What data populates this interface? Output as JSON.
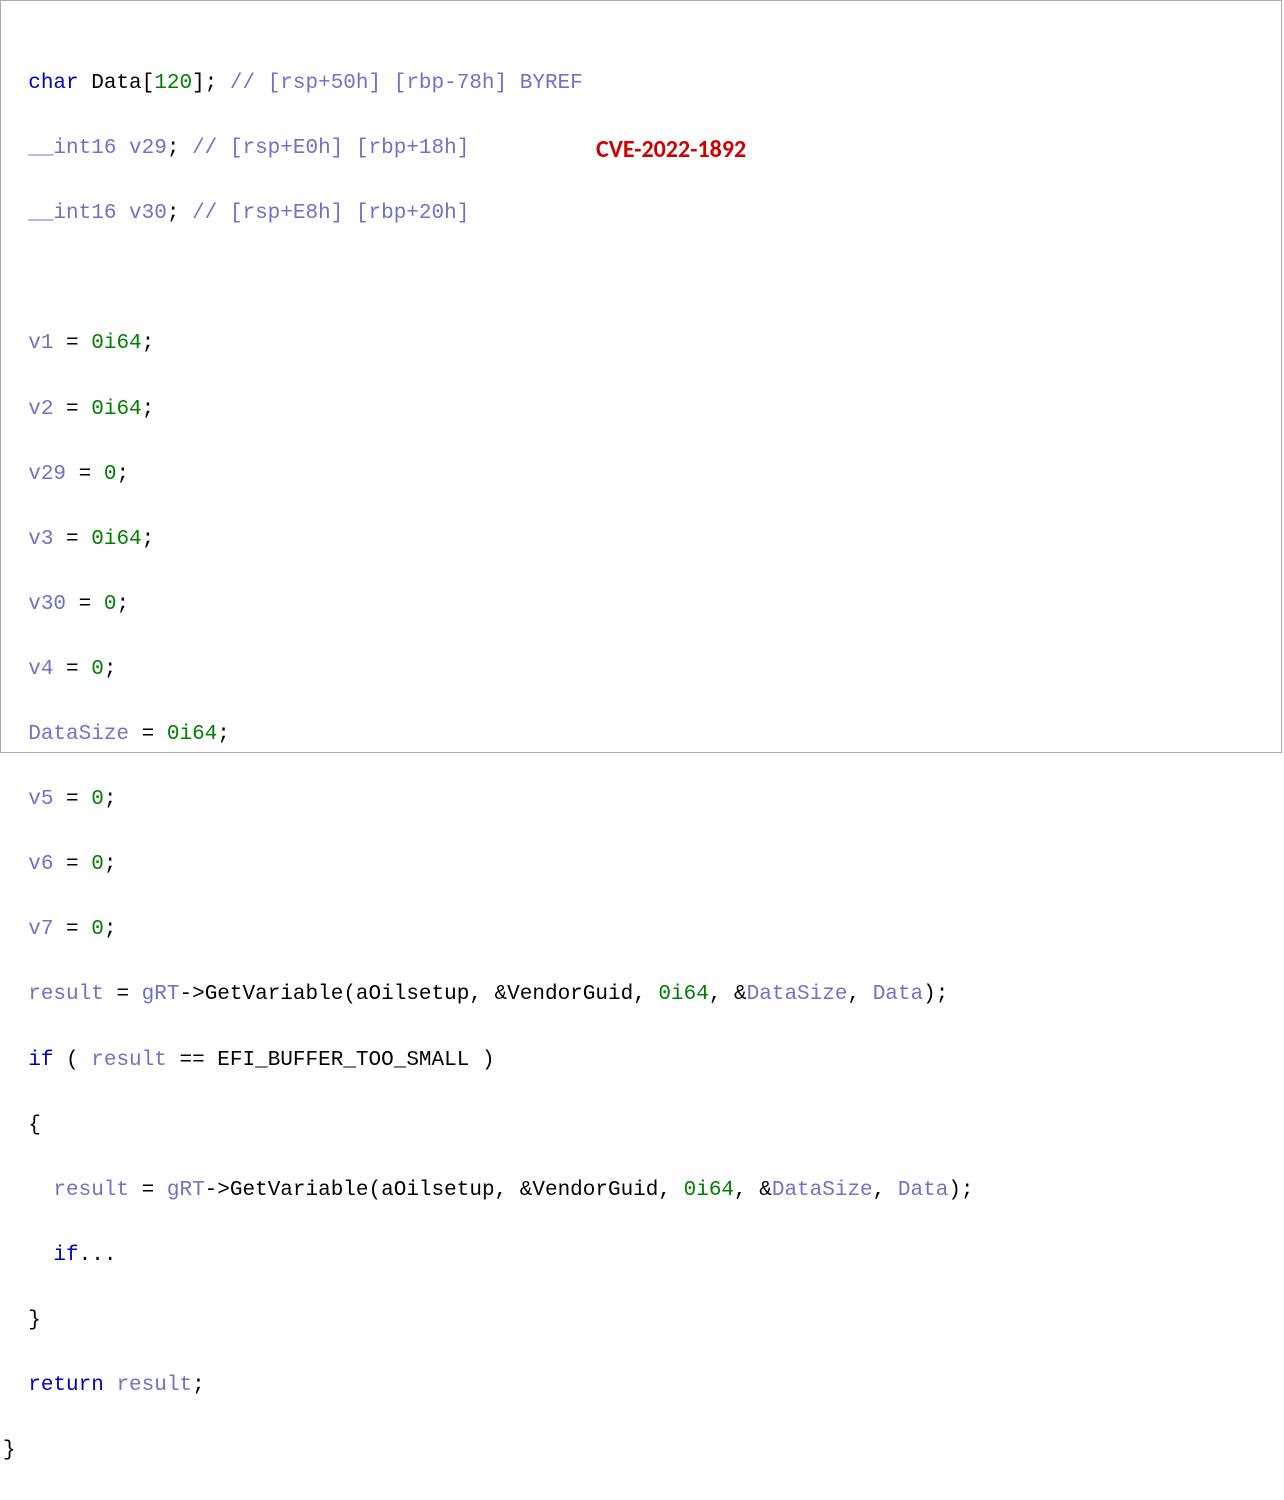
{
  "cve": "CVE-2022-1892",
  "lines": {
    "l1": {
      "indent": "  ",
      "t1": "char",
      "t2": " Data",
      "t3": "[",
      "t4": "120",
      "t5": "]; ",
      "t6": "// [rsp+50h] [rbp-78h] BYREF"
    },
    "l2": {
      "indent": "  ",
      "t1": "__int16 v29",
      "t2": "; ",
      "t3": "// [rsp+E0h] [rbp+18h]"
    },
    "l3": {
      "indent": "  ",
      "t1": "__int16 v30",
      "t2": "; ",
      "t3": "// [rsp+E8h] [rbp+20h]"
    },
    "l4": {
      "indent": ""
    },
    "l5": {
      "indent": "  ",
      "t1": "v1",
      "t2": " = ",
      "t3": "0i64",
      "t4": ";"
    },
    "l6": {
      "indent": "  ",
      "t1": "v2",
      "t2": " = ",
      "t3": "0i64",
      "t4": ";"
    },
    "l7": {
      "indent": "  ",
      "t1": "v29",
      "t2": " = ",
      "t3": "0",
      "t4": ";"
    },
    "l8": {
      "indent": "  ",
      "t1": "v3",
      "t2": " = ",
      "t3": "0i64",
      "t4": ";"
    },
    "l9": {
      "indent": "  ",
      "t1": "v30",
      "t2": " = ",
      "t3": "0",
      "t4": ";"
    },
    "l10": {
      "indent": "  ",
      "t1": "v4",
      "t2": " = ",
      "t3": "0",
      "t4": ";"
    },
    "l11": {
      "indent": "  ",
      "t1": "DataSize",
      "t2": " = ",
      "t3": "0i64",
      "t4": ";"
    },
    "l12": {
      "indent": "  ",
      "t1": "v5",
      "t2": " = ",
      "t3": "0",
      "t4": ";"
    },
    "l13": {
      "indent": "  ",
      "t1": "v6",
      "t2": " = ",
      "t3": "0",
      "t4": ";"
    },
    "l14": {
      "indent": "  ",
      "t1": "v7",
      "t2": " = ",
      "t3": "0",
      "t4": ";"
    },
    "l15": {
      "indent": "  ",
      "t1": "result",
      "t2": " = ",
      "t3": "gRT",
      "t4": "->",
      "t5": "GetVariable",
      "t6": "(",
      "t7": "aOilsetup",
      "t8": ", &",
      "t9": "VendorGuid",
      "t10": ", ",
      "t11": "0i64",
      "t12": ", &",
      "t13": "DataSize",
      "t14": ", ",
      "t15": "Data",
      "t16": ");"
    },
    "l16": {
      "indent": "  ",
      "t1": "if",
      "t2": " ( ",
      "t3": "result",
      "t4": " == ",
      "t5": "EFI_BUFFER_TOO_SMALL",
      "t6": " )"
    },
    "l17": {
      "indent": "  ",
      "t1": "{"
    },
    "l18": {
      "indent": "    ",
      "t1": "result",
      "t2": " = ",
      "t3": "gRT",
      "t4": "->",
      "t5": "GetVariable",
      "t6": "(",
      "t7": "aOilsetup",
      "t8": ", &",
      "t9": "VendorGuid",
      "t10": ", ",
      "t11": "0i64",
      "t12": ", &",
      "t13": "DataSize",
      "t14": ", ",
      "t15": "Data",
      "t16": ");"
    },
    "l19": {
      "indent": "    ",
      "t1": "if",
      "t2": "..."
    },
    "l20": {
      "indent": "  ",
      "t1": "}"
    },
    "l21": {
      "indent": "  ",
      "t1": "return",
      "t2": " ",
      "t3": "result",
      "t4": ";"
    },
    "l22": {
      "indent": "",
      "t1": "}"
    }
  }
}
